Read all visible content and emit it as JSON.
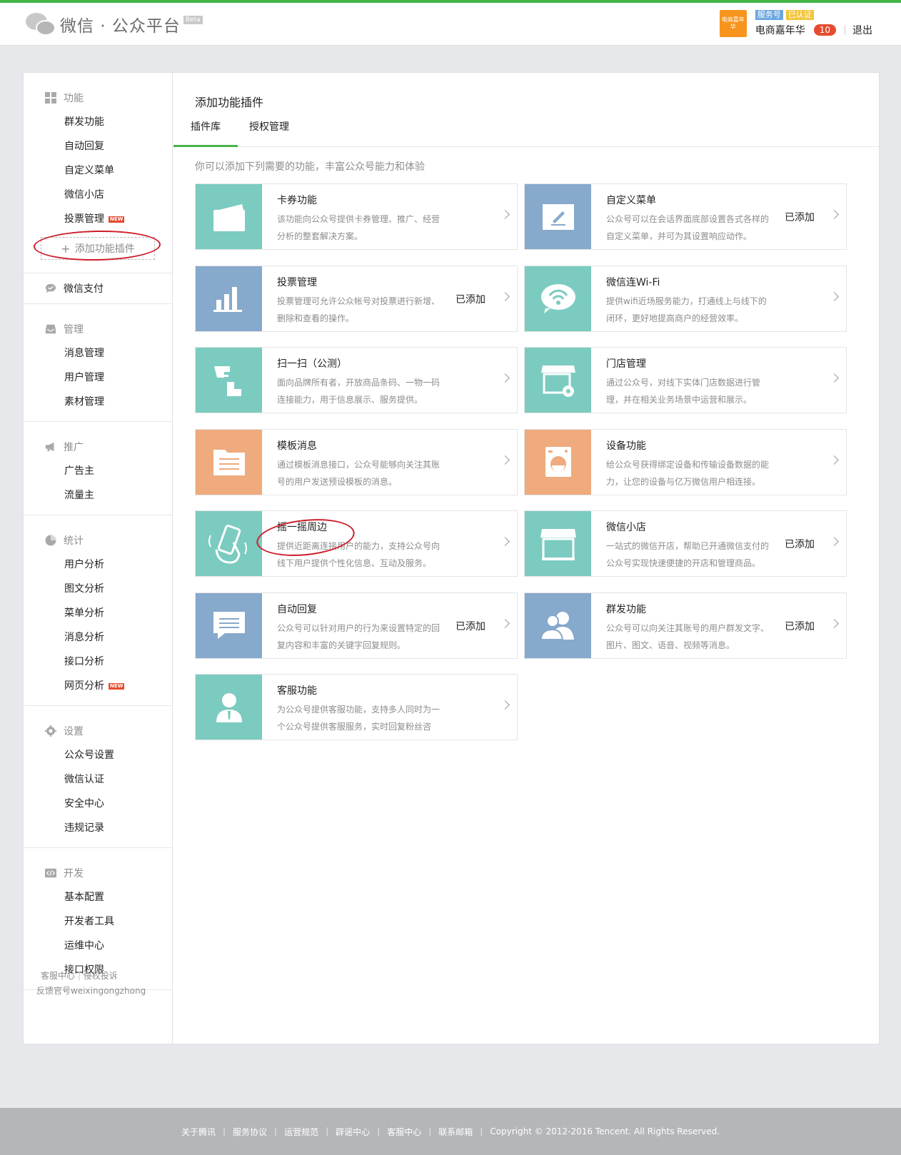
{
  "header": {
    "logo_text": "微信 · 公众平台",
    "beta": "Beta",
    "avatar_text": "电商嘉年华",
    "badge_service": "服务号",
    "badge_verified": "已认证",
    "account_name": "电商嘉年华",
    "notification_count": "10",
    "logout": "退出"
  },
  "sidebar": {
    "groups": [
      {
        "title": "功能",
        "icon": "grid-icon",
        "items": [
          "群发功能",
          "自动回复",
          "自定义菜单",
          "微信小店",
          "投票管理"
        ],
        "new_on": "投票管理"
      },
      {
        "title": "微信支付",
        "icon": "chat-bubble-icon",
        "items": []
      },
      {
        "title": "管理",
        "icon": "inbox-icon",
        "items": [
          "消息管理",
          "用户管理",
          "素材管理"
        ]
      },
      {
        "title": "推广",
        "icon": "megaphone-icon",
        "items": [
          "广告主",
          "流量主"
        ]
      },
      {
        "title": "统计",
        "icon": "pie-chart-icon",
        "items": [
          "用户分析",
          "图文分析",
          "菜单分析",
          "消息分析",
          "接口分析",
          "网页分析"
        ],
        "new_on": "网页分析"
      },
      {
        "title": "设置",
        "icon": "gear-icon",
        "items": [
          "公众号设置",
          "微信认证",
          "安全中心",
          "违规记录"
        ]
      },
      {
        "title": "开发",
        "icon": "code-icon",
        "items": [
          "基本配置",
          "开发者工具",
          "运维中心",
          "接口权限"
        ]
      }
    ],
    "new_tag": "NEW",
    "add_plugin": "添加功能插件",
    "footer_link1": "客服中心",
    "footer_link2": "侵权投诉",
    "footer_line2": "反馈官号weixingongzhong"
  },
  "main": {
    "title": "添加功能插件",
    "tab_library": "插件库",
    "tab_auth": "授权管理",
    "intro": "你可以添加下列需要的功能，丰富公众号能力和体验",
    "added_label": "已添加",
    "plugins": [
      {
        "title": "卡券功能",
        "desc": "该功能向公众号提供卡券管理、推广、经营分析的整套解决方案。",
        "added": false,
        "color": "#7bcbc0",
        "icon": "card-icon"
      },
      {
        "title": "自定义菜单",
        "desc": "公众号可以在会话界面底部设置各式各样的自定义菜单，并可为其设置响应动作。",
        "added": true,
        "color": "#86a9cc",
        "icon": "edit-icon"
      },
      {
        "title": "投票管理",
        "desc": "投票管理可允许公众帐号对投票进行新增、删除和查看的操作。",
        "added": true,
        "color": "#86a9cc",
        "icon": "bar-chart-icon"
      },
      {
        "title": "微信连Wi-Fi",
        "desc": "提供wifi近场服务能力，打通线上与线下的闭环，更好地提高商户的经营效率。",
        "added": false,
        "color": "#7bcbc0",
        "icon": "wifi-icon"
      },
      {
        "title": "扫一扫（公测）",
        "desc": "面向品牌所有者，开放商品条码、一物一码连接能力，用于信息展示、服务提供。",
        "added": false,
        "color": "#7bcbc0",
        "icon": "scan-icon"
      },
      {
        "title": "门店管理",
        "desc": "通过公众号，对线下实体门店数据进行管理，并在相关业务场景中运营和展示。",
        "added": false,
        "color": "#7bcbc0",
        "icon": "store-settings-icon"
      },
      {
        "title": "模板消息",
        "desc": "通过模板消息接口，公众号能够向关注其账号的用户发送预设模板的消息。",
        "added": false,
        "color": "#efaa7d",
        "icon": "template-icon"
      },
      {
        "title": "设备功能",
        "desc": "给公众号获得绑定设备和传输设备数据的能力，让您的设备与亿万微信用户相连接。",
        "added": false,
        "color": "#efaa7d",
        "icon": "device-icon"
      },
      {
        "title": "摇一摇周边",
        "desc": "提供近距离连接用户的能力，支持公众号向线下用户提供个性化信息、互动及服务。",
        "added": false,
        "color": "#7bcbc0",
        "icon": "shake-icon"
      },
      {
        "title": "微信小店",
        "desc": "一站式的微信开店，帮助已开通微信支付的公众号实现快速便捷的开店和管理商品。",
        "added": true,
        "color": "#7bcbc0",
        "icon": "shop-icon"
      },
      {
        "title": "自动回复",
        "desc": "公众号可以针对用户的行为来设置特定的回复内容和丰富的关键字回复规则。",
        "added": true,
        "color": "#86a9cc",
        "icon": "message-icon"
      },
      {
        "title": "群发功能",
        "desc": "公众号可以向关注其账号的用户群发文字、图片、图文、语音、视频等消息。",
        "added": true,
        "color": "#86a9cc",
        "icon": "users-icon"
      },
      {
        "title": "客服功能",
        "desc": "为公众号提供客服功能，支持多人同时为一个公众号提供客服服务，实时回复粉丝咨询。",
        "added": false,
        "color": "#7bcbc0",
        "icon": "agent-icon"
      }
    ]
  },
  "footer": {
    "links": [
      "关于腾讯",
      "服务协议",
      "运营规范",
      "辟谣中心",
      "客服中心",
      "联系邮箱"
    ],
    "copyright": "Copyright © 2012-2016 Tencent. All Rights Reserved."
  }
}
